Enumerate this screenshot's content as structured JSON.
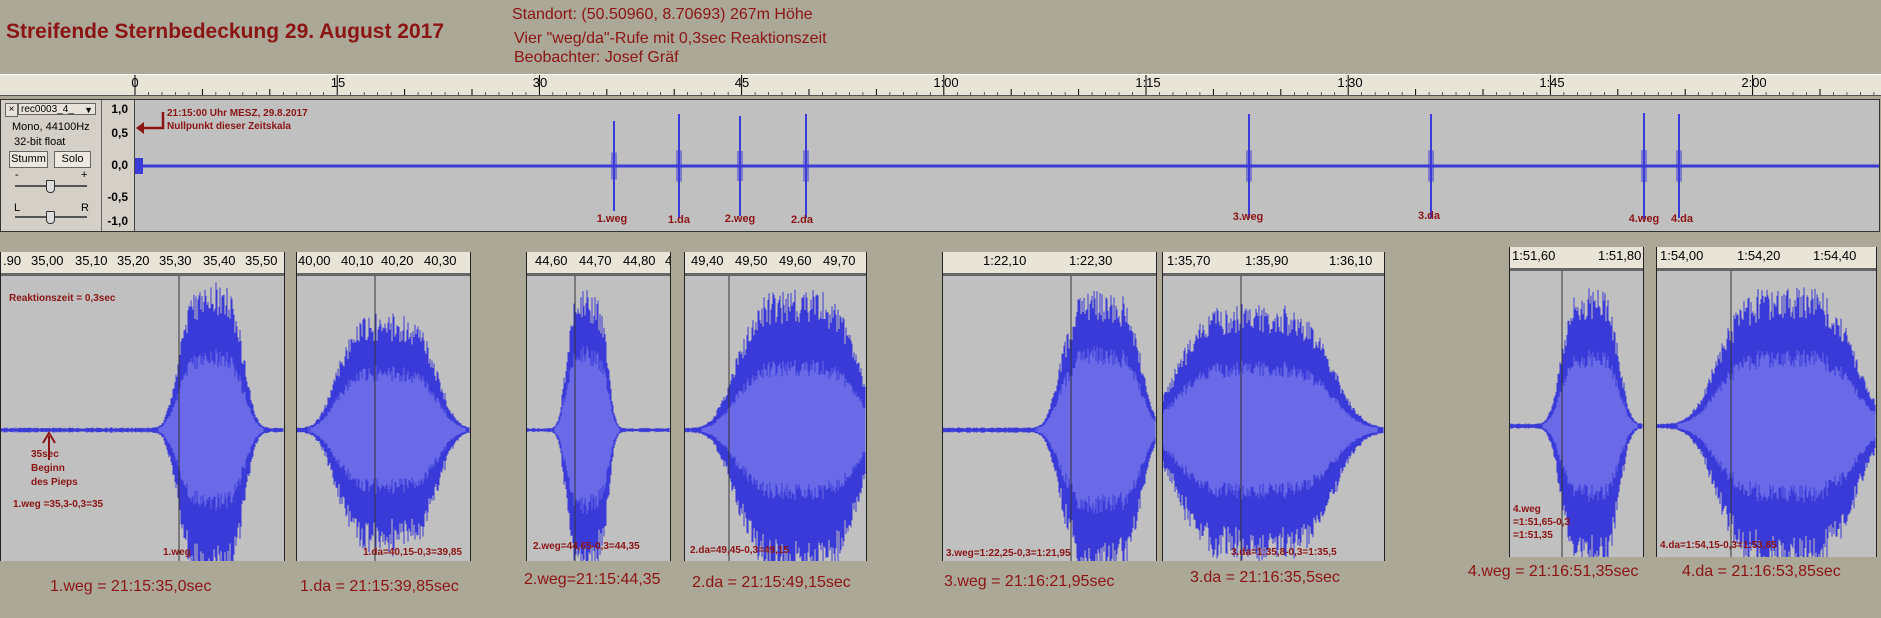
{
  "title": "Streifende Sternbedeckung 29. August 2017",
  "info": {
    "line1": "Standort: (50.50960, 8.70693)   267m Höhe",
    "line2": "Vier  \"weg/da\"-Rufe mit 0,3sec Reaktionszeit",
    "line3": "Beobachter: Josef Gräf"
  },
  "ruler": [
    "0",
    "15",
    "30",
    "45",
    "1:00",
    "1:15",
    "1:30",
    "1:45",
    "2:00"
  ],
  "track_panel": {
    "close": "×",
    "name": "rec0003_4_",
    "info1": "Mono, 44100Hz",
    "info2": "32-bit float",
    "mute": "Stumm",
    "solo": "Solo",
    "gain_minus": "-",
    "gain_plus": "+",
    "pan_left": "L",
    "pan_right": "R"
  },
  "scale": [
    "1,0",
    "0,5",
    "0,0",
    "-0,5",
    "-1,0"
  ],
  "annotation": {
    "line1": "21:15:00 Uhr MESZ, 29.8.2017",
    "line2": "Nullpunkt dieser Zeitskala"
  },
  "track_labels": [
    "1.weg",
    "1.da",
    "2.weg",
    "2.da",
    "3.weg",
    "3.da",
    "4.weg",
    "4.da"
  ],
  "clips": [
    {
      "ruler": [
        ".90",
        "35,00",
        "35,10",
        "35,20",
        "35,30",
        "35,40",
        "35,50"
      ],
      "notes": [
        "Reaktionszeit = 0,3sec",
        "35sec",
        "Beginn",
        "des Pieps",
        "1.weg =35,3-0,3=35",
        "1.weg"
      ],
      "bottom": "1.weg = 21:15:35,0sec"
    },
    {
      "ruler": [
        "40,00",
        "40,10",
        "40,20",
        "40,30"
      ],
      "notes": [
        "1.da=40,15-0,3=39,85"
      ],
      "bottom": "1.da = 21:15:39,85sec"
    },
    {
      "ruler": [
        "44,60",
        "44,70",
        "44,80",
        "4"
      ],
      "notes": [
        "2.weg=44,65-0,3=44,35"
      ],
      "bottom": "2.weg=21:15:44,35"
    },
    {
      "ruler": [
        "49,40",
        "49,50",
        "49,60",
        "49,70"
      ],
      "notes": [
        "2.da=49,45-0,3=49,15"
      ],
      "bottom": "2.da = 21:15:49,15sec"
    },
    {
      "ruler": [
        "1:22,10",
        "1:22,30"
      ],
      "notes": [
        "3.weg=1:22,25-0,3=1:21,95"
      ],
      "bottom": "3.weg = 21:16:21,95sec"
    },
    {
      "ruler": [
        "1:35,70",
        "1:35,90",
        "1:36,10"
      ],
      "notes": [
        "3.da=1:35,8-0,3=1:35,5"
      ],
      "bottom": "3.da  = 21:16:35,5sec"
    },
    {
      "ruler": [
        "1:51,60",
        "1:51,80"
      ],
      "notes": [
        "4.weg",
        "=1:51,65-0,3",
        "=1:51,35"
      ],
      "bottom": "4.weg = 21:16:51,35sec"
    },
    {
      "ruler": [
        "1:54,00",
        "1:54,20",
        "1:54,40"
      ],
      "notes": [
        "4.da=1:54,15-0,3=1:53,85"
      ],
      "bottom": "4.da = 21:16:53,85sec"
    }
  ],
  "colors": {
    "background": "#aca898",
    "waveform": "#3a3ad8",
    "waveform_rms": "#6a6ae8",
    "annotation": "#8b1414",
    "track_bg": "#c0c0c0"
  }
}
